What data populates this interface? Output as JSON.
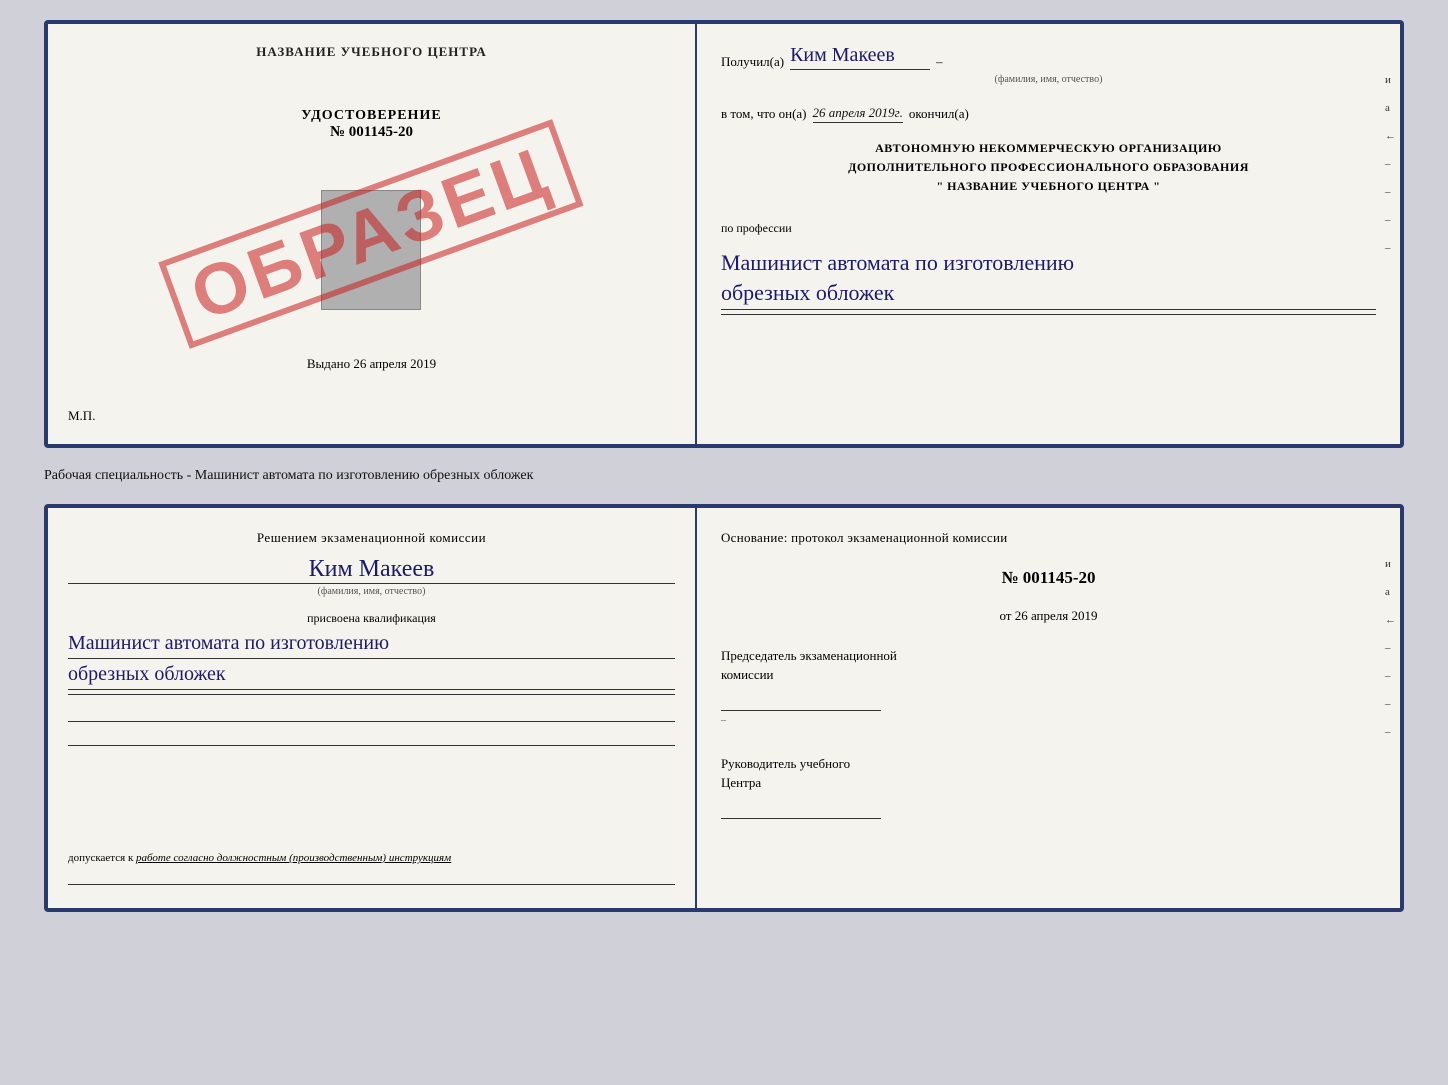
{
  "top_left": {
    "title": "НАЗВАНИЕ УЧЕБНОГО ЦЕНТРА",
    "udostoverenie_label": "УДОСТОВЕРЕНИЕ",
    "number": "№ 001145-20",
    "vydano_label": "Выдано",
    "vydano_date": "26 апреля 2019",
    "mp": "М.П.",
    "stamp": "ОБРАЗЕЦ"
  },
  "top_right": {
    "poluchil_label": "Получил(а)",
    "recipient_name": "Ким Макеев",
    "fio_sub": "(фамилия, имя, отчество)",
    "vtom_prefix": "в том, что он(а)",
    "completed_date": "26 апреля 2019г.",
    "okoncil_label": "окончил(а)",
    "org_line1": "АВТОНОМНУЮ НЕКОММЕРЧЕСКУЮ ОРГАНИЗАЦИЮ",
    "org_line2": "ДОПОЛНИТЕЛЬНОГО ПРОФЕССИОНАЛЬНОГО ОБРАЗОВАНИЯ",
    "org_line3": "\"  НАЗВАНИЕ УЧЕБНОГО ЦЕНТРА  \"",
    "professiya_label": "по профессии",
    "profession_line1": "Машинист автомата по изготовлению",
    "profession_line2": "обрезных обложек",
    "side_marks": [
      "и",
      "а",
      "←",
      "–",
      "–",
      "–",
      "–"
    ]
  },
  "caption": "Рабочая специальность - Машинист автомата по изготовлению обрезных обложек",
  "bottom_left": {
    "commission_line1": "Решением экзаменационной комиссии",
    "recipient_name": "Ким Макеев",
    "fio_sub": "(фамилия, имя, отчество)",
    "prisvoena_label": "присвоена квалификация",
    "profession_line1": "Машинист автомата по изготовлению",
    "profession_line2": "обрезных обложек",
    "dopuskaetsya_prefix": "допускается к",
    "dopuskaetsya_text": "работе согласно должностным (производственным) инструкциям"
  },
  "bottom_right": {
    "osnov_label": "Основание: протокол экзаменационной комиссии",
    "number": "№  001145-20",
    "ot_prefix": "от",
    "ot_date": "26 апреля 2019",
    "chairman_label1": "Председатель экзаменационной",
    "chairman_label2": "комиссии",
    "rukovoditel_label1": "Руководитель учебного",
    "rukovoditel_label2": "Центра",
    "side_marks": [
      "и",
      "а",
      "←",
      "–",
      "–",
      "–",
      "–"
    ]
  }
}
